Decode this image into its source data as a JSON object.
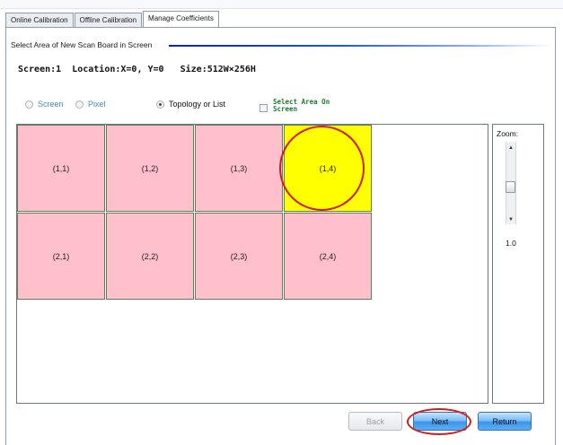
{
  "tabs": [
    {
      "label": "Online Calibration",
      "active": false
    },
    {
      "label": "Offline Calibration",
      "active": false
    },
    {
      "label": "Manage Coefficients",
      "active": true
    }
  ],
  "group": {
    "title": "Select Area of New Scan Board in Screen"
  },
  "info": {
    "text": "Screen:1  Location:X=0, Y=0   Size:512W×256H"
  },
  "options": {
    "screen_label": "Screen",
    "pixel_label": "Pixel",
    "topology_label": "Topology or List",
    "select_area_label": "Select Area On Screen",
    "selected": "Topology or List"
  },
  "grid": {
    "rows": [
      [
        {
          "label": "(1,1)",
          "selected": false
        },
        {
          "label": "(1,2)",
          "selected": false
        },
        {
          "label": "(1,3)",
          "selected": false
        },
        {
          "label": "(1,4)",
          "selected": true
        }
      ],
      [
        {
          "label": "(2,1)",
          "selected": false
        },
        {
          "label": "(2,2)",
          "selected": false
        },
        {
          "label": "(2,3)",
          "selected": false
        },
        {
          "label": "(2,4)",
          "selected": false
        }
      ]
    ]
  },
  "zoom": {
    "label": "Zoom:",
    "value": "1.0"
  },
  "buttons": {
    "back": "Back",
    "next": "Next",
    "return": "Return"
  },
  "colors": {
    "cell_default": "#ffc0cb",
    "cell_selected": "#ffff00",
    "annotation": "#d21d1d",
    "checkbox_label": "#1c7a2a"
  }
}
